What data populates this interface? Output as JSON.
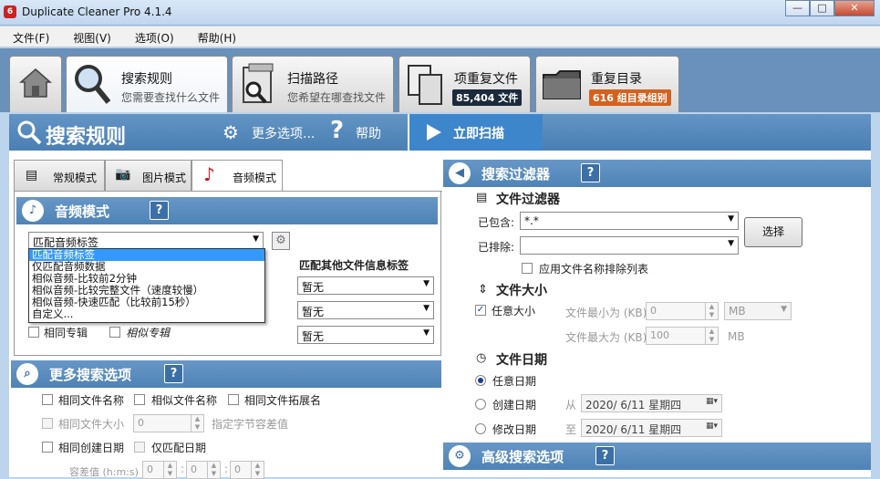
{
  "window": {
    "title": "Duplicate Cleaner Pro 4.1.4",
    "min": "—",
    "max": "□",
    "close": "✕"
  },
  "menu": [
    "文件(F)",
    "视图(V)",
    "选项(O)",
    "帮助(H)"
  ],
  "tabs": [
    {
      "title": "搜索规则",
      "sub": "您需要查找什么文件"
    },
    {
      "title": "扫描路径",
      "sub": "您希望在哪查找文件"
    },
    {
      "title": "项重复文件",
      "badge": "85,404 文件",
      "badge_color": "#1b2b3b"
    },
    {
      "title": "重复目录",
      "badge": "616 组目录组别",
      "badge_color": "#d4621e"
    }
  ],
  "header": {
    "title": "搜索规则",
    "more": "更多选项...",
    "help": "帮助",
    "scan": "立即扫描"
  },
  "subtabs": [
    "常规模式",
    "图片模式",
    "音频模式"
  ],
  "audio": {
    "title": "音频模式",
    "help": "?",
    "select_value": "匹配音频标签",
    "dropdown": [
      "匹配音频标签",
      "仅匹配音频数据",
      "相似音频-比较前2分钟",
      "相似音频-比较完整文件（速度较慢）",
      "相似音频-快速匹配（比较前15秒）",
      "自定义..."
    ],
    "other_label": "匹配其他文件信息标签",
    "other_selects": [
      "暂无",
      "暂无",
      "暂无"
    ],
    "same_album": "相同专辑",
    "similar_album": "相似专辑"
  },
  "more": {
    "title": "更多搜索选项",
    "same_name": "相同文件名称",
    "similar_name": "相似文件名称",
    "same_ext": "相同文件拓展名",
    "same_size": "相同文件大小",
    "size_value": "0",
    "size_hint": "指定字节容差值",
    "same_created": "相同创建日期",
    "date_only": "仅匹配日期",
    "tolerance": "容差值 (h:m:s)",
    "t_h": "0",
    "t_m": "0",
    "t_s": "0"
  },
  "filter": {
    "title": "搜索过滤器",
    "file_filter": "文件过滤器",
    "include_label": "已包含:",
    "include_value": "*.*",
    "exclude_label": "已排除:",
    "exclude_value": "",
    "choose": "选择",
    "apply_exclude": "应用文件名称排除列表",
    "size_title": "文件大小",
    "any_size": "任意大小",
    "min_label": "文件最小为 (KB)",
    "min_value": "0",
    "unit": "MB",
    "max_label": "文件最大为 (KB)",
    "max_value": "100",
    "max_unit": "MB",
    "date_title": "文件日期",
    "any_date": "任意日期",
    "created": "创建日期",
    "modified": "修改日期",
    "from": "从",
    "to": "至",
    "from_value": "2020/ 6/11 星期四",
    "to_value": "2020/ 6/11 星期四"
  },
  "advanced": {
    "title": "高级搜索选项"
  }
}
